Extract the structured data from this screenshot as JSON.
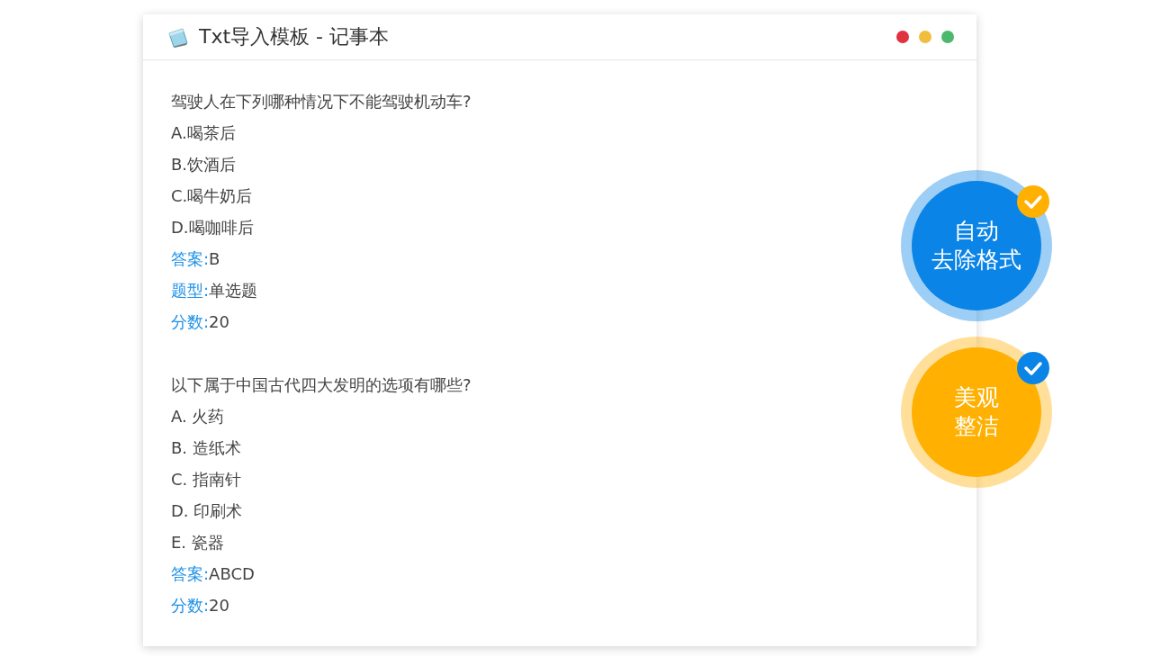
{
  "window": {
    "title": "Txt导入模板 - 记事本",
    "controls": [
      {
        "color": "#e0323f"
      },
      {
        "color": "#f0be3c"
      },
      {
        "color": "#4cb86e"
      }
    ]
  },
  "questions": [
    {
      "lines": [
        {
          "kind": "text",
          "text": "驾驶人在下列哪种情况下不能驾驶机动车?"
        },
        {
          "kind": "text",
          "text": "A.喝茶后"
        },
        {
          "kind": "text",
          "text": "B.饮酒后"
        },
        {
          "kind": "text",
          "text": "C.喝牛奶后"
        },
        {
          "kind": "text",
          "text": "D.喝咖啡后"
        },
        {
          "kind": "field",
          "label": "答案:",
          "value": "B"
        },
        {
          "kind": "field",
          "label": "题型:",
          "value": "单选题"
        },
        {
          "kind": "field",
          "label": "分数:",
          "value": "20"
        }
      ]
    },
    {
      "lines": [
        {
          "kind": "text",
          "text": "以下属于中国古代四大发明的选项有哪些?"
        },
        {
          "kind": "text",
          "text": "A. 火药"
        },
        {
          "kind": "text",
          "text": "B. 造纸术"
        },
        {
          "kind": "text",
          "text": "C. 指南针"
        },
        {
          "kind": "text",
          "text": "D. 印刷术"
        },
        {
          "kind": "text",
          "text": "E. 瓷器"
        },
        {
          "kind": "field",
          "label": "答案:",
          "value": "ABCD"
        },
        {
          "kind": "field",
          "label": "分数:",
          "value": "20"
        }
      ]
    }
  ],
  "badges": [
    {
      "lines": [
        "自动",
        "去除格式"
      ],
      "color": "#0a84e6",
      "check": {
        "color": "#ffb000"
      }
    },
    {
      "lines": [
        "美观",
        "整洁"
      ],
      "color": "#ffb000",
      "check": {
        "color": "#0a84e6"
      }
    }
  ]
}
